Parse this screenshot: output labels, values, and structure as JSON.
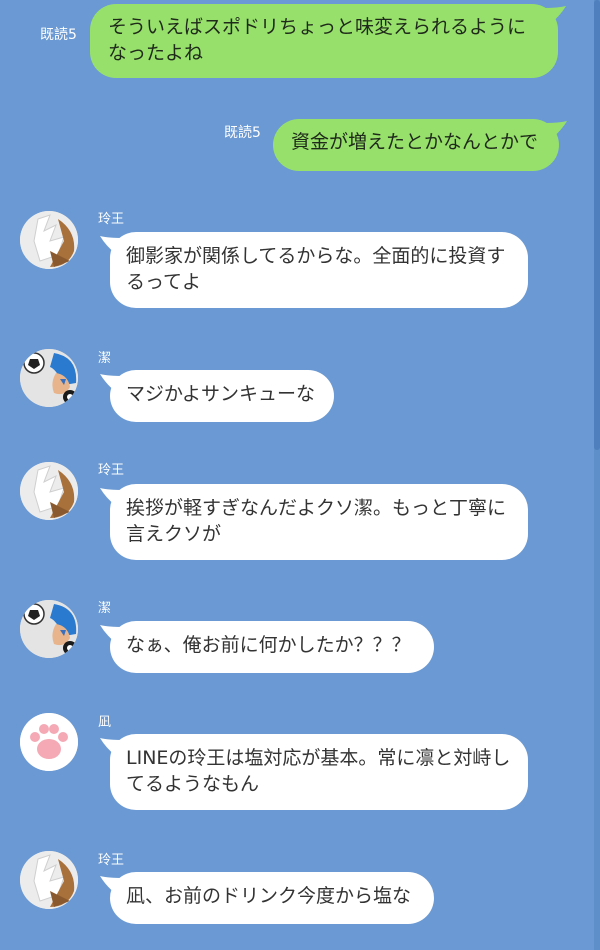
{
  "messages": [
    {
      "type": "sent",
      "read": "既読5",
      "text": "そういえばスポドリちょっと味変えられるようになったよね"
    },
    {
      "type": "sent",
      "read": "既読5",
      "text": "資金が増えたとかなんとかで"
    },
    {
      "type": "received",
      "sender": "玲王",
      "avatar": "reo-avatar",
      "text": "御影家が関係してるからな。全面的に投資するってよ"
    },
    {
      "type": "received",
      "sender": "潔",
      "avatar": "isagi-avatar",
      "text": "マジかよサンキューな"
    },
    {
      "type": "received",
      "sender": "玲王",
      "avatar": "reo-avatar",
      "text": "挨拶が軽すぎなんだよクソ潔。もっと丁寧に言えクソが"
    },
    {
      "type": "received",
      "sender": "潔",
      "avatar": "isagi-avatar",
      "text": "なぁ、俺お前に何かしたか？？？"
    },
    {
      "type": "received",
      "sender": "凪",
      "avatar": "nagi-avatar",
      "text": "LINEの玲王は塩対応が基本。常に凛と対峙してるようなもん"
    },
    {
      "type": "received",
      "sender": "玲王",
      "avatar": "reo-avatar",
      "text": "凪、お前のドリンク今度から塩な"
    }
  ],
  "colors": {
    "background": "#6a99d3",
    "sent_bubble": "#97e06b",
    "received_bubble": "#ffffff"
  }
}
